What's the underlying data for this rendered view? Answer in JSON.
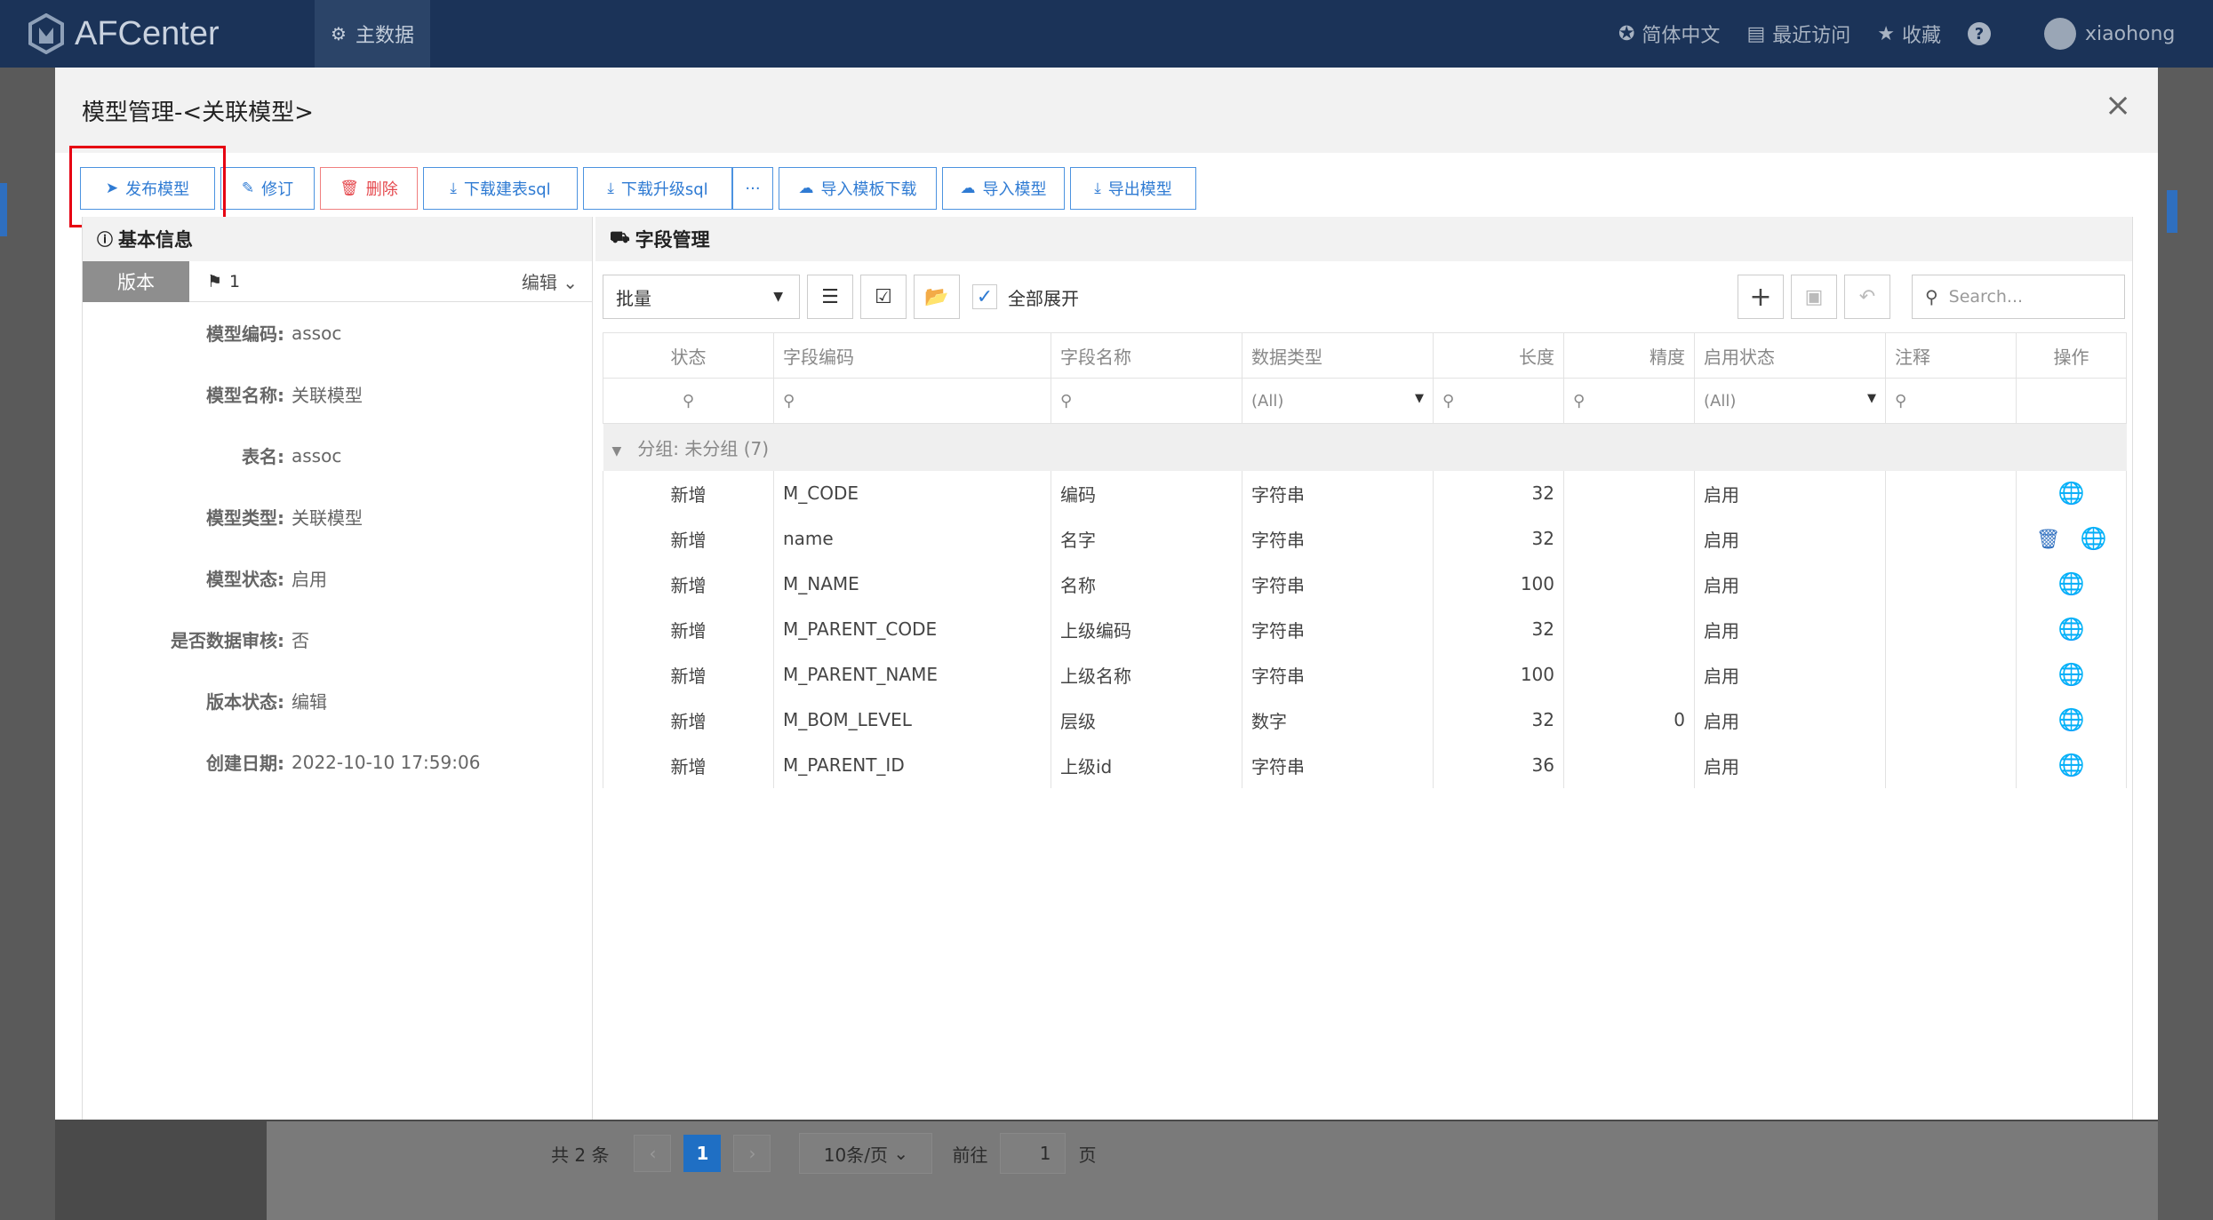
{
  "app": {
    "name": "AFCenter"
  },
  "topnav": {
    "main_data": "主数据"
  },
  "top_right": {
    "language": "简体中文",
    "recent": "最近访问",
    "favorites": "收藏",
    "help": "?",
    "user": "xiaohong"
  },
  "modal": {
    "title": "模型管理-<关联模型>",
    "close": "×"
  },
  "toolbar": {
    "publish": "发布模型",
    "revise": "修订",
    "delete": "删除",
    "download_create_sql": "下载建表sql",
    "download_upgrade_sql": "下载升级sql",
    "more": "···",
    "import_template_download": "导入模板下载",
    "import_model": "导入模型",
    "export_model": "导出模型"
  },
  "basic_info": {
    "title": "基本信息",
    "version_tab": "版本",
    "version_value": "1",
    "edit": "编辑",
    "rows": [
      {
        "k": "模型编码:",
        "v": "assoc"
      },
      {
        "k": "模型名称:",
        "v": "关联模型"
      },
      {
        "k": "表名:",
        "v": "assoc"
      },
      {
        "k": "模型类型:",
        "v": "关联模型"
      },
      {
        "k": "模型状态:",
        "v": "启用"
      },
      {
        "k": "是否数据审核:",
        "v": "否"
      },
      {
        "k": "版本状态:",
        "v": "编辑"
      },
      {
        "k": "创建日期:",
        "v": "2022-10-10 17:59:06"
      }
    ]
  },
  "fields": {
    "title": "字段管理",
    "batch": "批量",
    "expand_all": "全部展开",
    "search_placeholder": "Search...",
    "columns": [
      "状态",
      "字段编码",
      "字段名称",
      "数据类型",
      "长度",
      "精度",
      "启用状态",
      "注释",
      "操作"
    ],
    "filter_all": "(All)",
    "group_label": "分组: 未分组 (7)",
    "rows": [
      {
        "status": "新增",
        "code": "M_CODE",
        "name": "编码",
        "type": "字符串",
        "length": "32",
        "precision": "",
        "enabled": "启用",
        "note": ""
      },
      {
        "status": "新增",
        "code": "name",
        "name": "名字",
        "type": "字符串",
        "length": "32",
        "precision": "",
        "enabled": "启用",
        "note": ""
      },
      {
        "status": "新增",
        "code": "M_NAME",
        "name": "名称",
        "type": "字符串",
        "length": "100",
        "precision": "",
        "enabled": "启用",
        "note": ""
      },
      {
        "status": "新增",
        "code": "M_PARENT_CODE",
        "name": "上级编码",
        "type": "字符串",
        "length": "32",
        "precision": "",
        "enabled": "启用",
        "note": ""
      },
      {
        "status": "新增",
        "code": "M_PARENT_NAME",
        "name": "上级名称",
        "type": "字符串",
        "length": "100",
        "precision": "",
        "enabled": "启用",
        "note": ""
      },
      {
        "status": "新增",
        "code": "M_BOM_LEVEL",
        "name": "层级",
        "type": "数字",
        "length": "32",
        "precision": "0",
        "enabled": "启用",
        "note": ""
      },
      {
        "status": "新增",
        "code": "M_PARENT_ID",
        "name": "上级id",
        "type": "字符串",
        "length": "36",
        "precision": "",
        "enabled": "启用",
        "note": ""
      }
    ]
  },
  "pager": {
    "total": "共 2 条",
    "current": "1",
    "page_size": "10条/页",
    "goto": "前往",
    "goto_value": "1",
    "page": "页"
  }
}
